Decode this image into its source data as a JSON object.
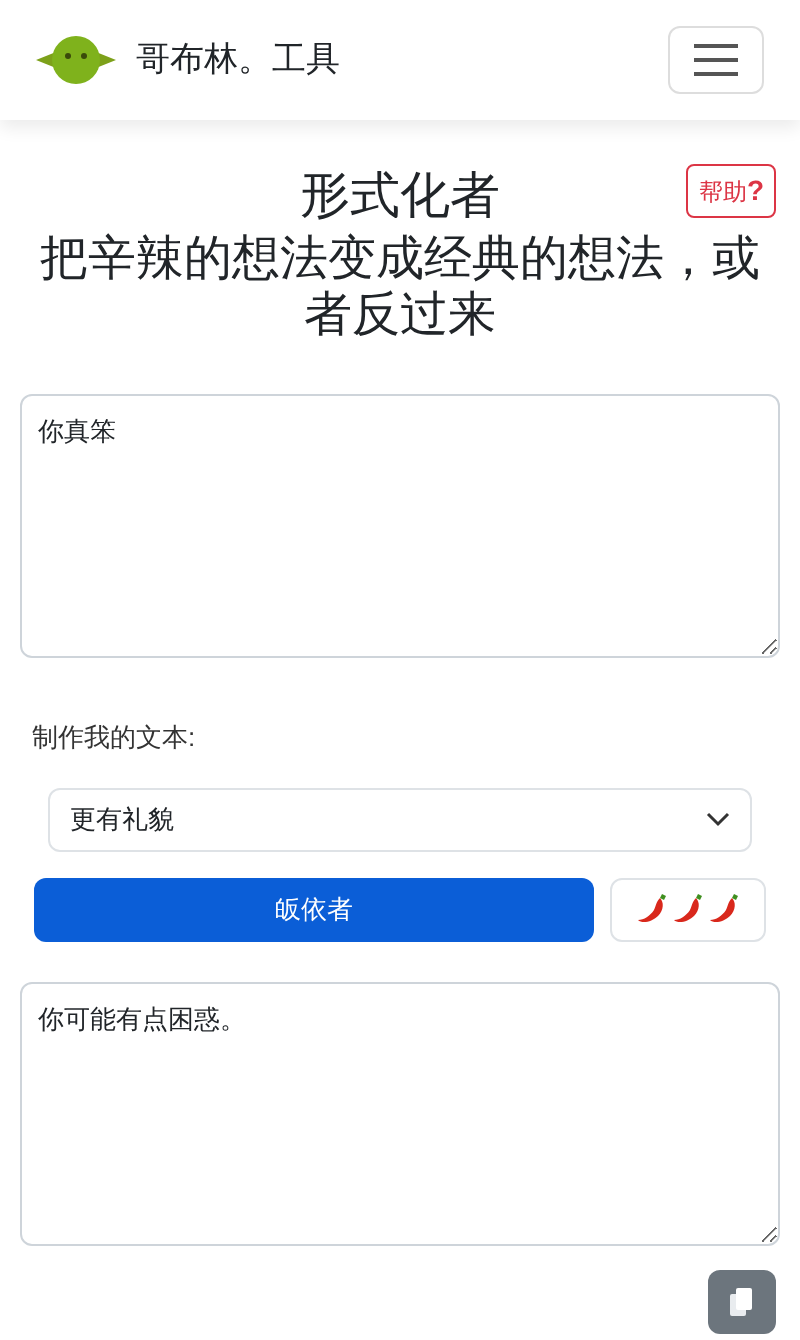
{
  "navbar": {
    "brand": "哥布林。工具"
  },
  "help_button": "帮助",
  "help_mark": "?",
  "title": "形式化者",
  "subtitle": "把辛辣的想法变成经典的想法，或者反过来",
  "input": {
    "value": "你真笨"
  },
  "select_label": "制作我的文本:",
  "select": {
    "value": "更有礼貌"
  },
  "submit_button": "皈依者",
  "output": {
    "value": "你可能有点困惑。"
  }
}
